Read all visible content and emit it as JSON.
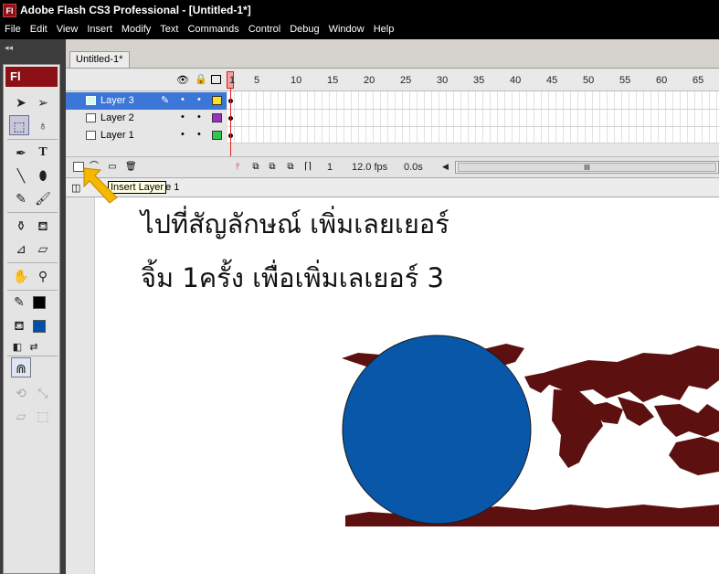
{
  "window": {
    "app_icon": "Fl",
    "title": "Adobe Flash CS3 Professional - [Untitled-1*]"
  },
  "menu": [
    "File",
    "Edit",
    "View",
    "Insert",
    "Modify",
    "Text",
    "Commands",
    "Control",
    "Debug",
    "Window",
    "Help"
  ],
  "collapse_glyph": "◂◂",
  "tools_panel": {
    "logo": "Fl",
    "tools": [
      "selection-tool",
      "subselection-tool",
      "free-transform-tool",
      "lasso-tool",
      "pen-tool",
      "text-tool",
      "line-tool",
      "oval-tool",
      "pencil-tool",
      "brush-tool",
      "ink-bottle-tool",
      "paint-bucket-tool",
      "eyedropper-tool",
      "eraser-tool",
      "hand-tool",
      "zoom-tool"
    ],
    "stroke_color": "#000000",
    "fill_color": "#0050a8"
  },
  "document_tab": "Untitled-1*",
  "timeline": {
    "header_icons": [
      "eye-icon",
      "lock-icon",
      "outline-icon"
    ],
    "frame_numbers": [
      "1",
      "5",
      "10",
      "15",
      "20",
      "25",
      "30",
      "35",
      "40",
      "45",
      "50",
      "55",
      "60",
      "65"
    ],
    "layers": [
      {
        "name": "Layer 3",
        "selected": true,
        "outline_color": "#ffe020"
      },
      {
        "name": "Layer 2",
        "selected": false,
        "outline_color": "#9a30c8"
      },
      {
        "name": "Layer 1",
        "selected": false,
        "outline_color": "#30c850"
      }
    ],
    "status": {
      "current_frame": "1",
      "fps": "12.0 fps",
      "time": "0.0s"
    },
    "scroll_thumb": "III"
  },
  "edit_bar": {
    "scene": "Scene 1"
  },
  "tooltip": "Insert Layer",
  "stage": {
    "line1": "ไปที่สัญลักษณ์ เพิ่มเลยเยอร์",
    "line2": "จิ้ม 1ครั้ง เพื่อเพิ่มเลเยอร์ 3",
    "circle_color": "#0857a8",
    "map_color": "#5c1010"
  },
  "annotation_arrow_color": "#f5b800"
}
